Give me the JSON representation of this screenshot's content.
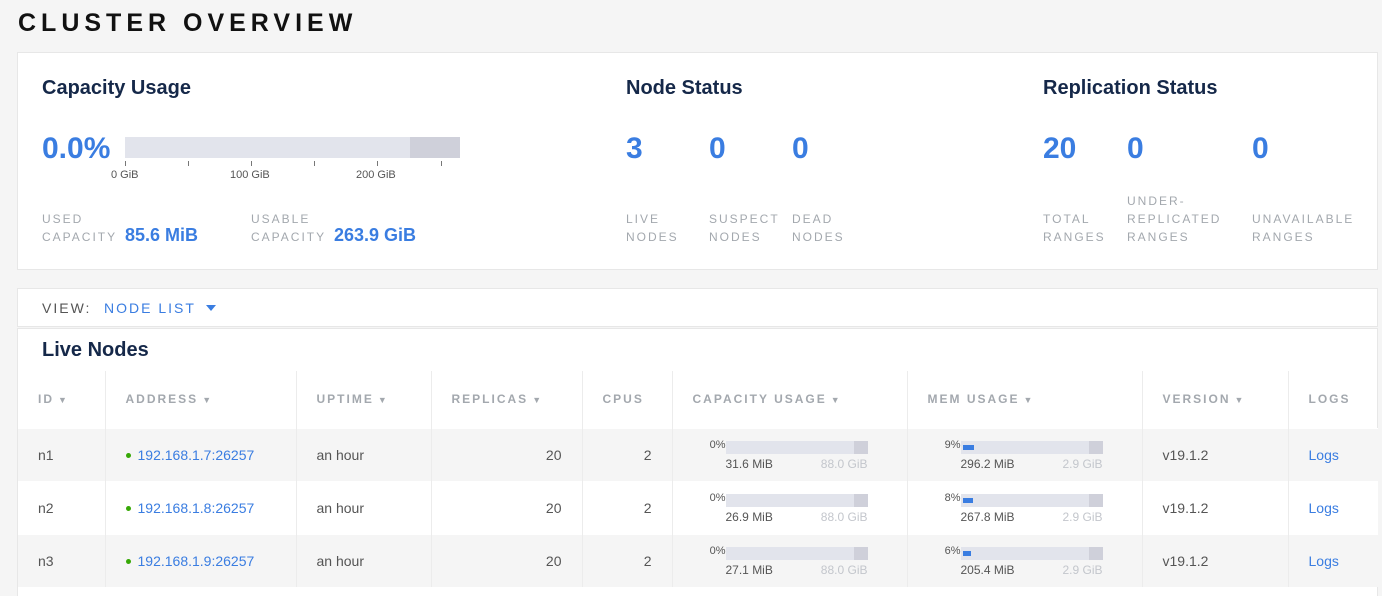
{
  "page": {
    "title": "CLUSTER OVERVIEW"
  },
  "capacity": {
    "title": "Capacity Usage",
    "percent": "0.0%",
    "fill_fraction": 0.0,
    "ticks": [
      "0 GiB",
      "100 GiB",
      "200 GiB"
    ],
    "used_label": "USED CAPACITY",
    "used_value": "85.6 MiB",
    "usable_label": "USABLE CAPACITY",
    "usable_value": "263.9 GiB"
  },
  "node_status": {
    "title": "Node Status",
    "live": "3",
    "live_label": "LIVE NODES",
    "suspect": "0",
    "suspect_label": "SUSPECT NODES",
    "dead": "0",
    "dead_label": "DEAD NODES"
  },
  "replication": {
    "title": "Replication Status",
    "total": "20",
    "total_label": "TOTAL RANGES",
    "under": "0",
    "under_label": "UNDER-REPLICATED RANGES",
    "unavailable": "0",
    "unavailable_label": "UNAVAILABLE RANGES"
  },
  "view": {
    "label": "VIEW:",
    "selected": "NODE LIST"
  },
  "live_nodes": {
    "title": "Live Nodes",
    "columns": {
      "id": "ID",
      "address": "ADDRESS",
      "uptime": "UPTIME",
      "replicas": "REPLICAS",
      "cpus": "CPUS",
      "capacity": "CAPACITY USAGE",
      "mem": "MEM USAGE",
      "version": "VERSION",
      "logs": "LOGS"
    },
    "sort_arrow": "▼",
    "rows": [
      {
        "id": "n1",
        "address": "192.168.1.7:26257",
        "uptime": "an hour",
        "replicas": "20",
        "cpus": "2",
        "cap_pct": "0%",
        "cap_fill": 0.0,
        "cap_used": "31.6 MiB",
        "cap_total": "88.0 GiB",
        "mem_pct": "9%",
        "mem_fill": 0.09,
        "mem_used": "296.2 MiB",
        "mem_total": "2.9 GiB",
        "version": "v19.1.2",
        "logs": "Logs"
      },
      {
        "id": "n2",
        "address": "192.168.1.8:26257",
        "uptime": "an hour",
        "replicas": "20",
        "cpus": "2",
        "cap_pct": "0%",
        "cap_fill": 0.0,
        "cap_used": "26.9 MiB",
        "cap_total": "88.0 GiB",
        "mem_pct": "8%",
        "mem_fill": 0.08,
        "mem_used": "267.8 MiB",
        "mem_total": "2.9 GiB",
        "version": "v19.1.2",
        "logs": "Logs"
      },
      {
        "id": "n3",
        "address": "192.168.1.9:26257",
        "uptime": "an hour",
        "replicas": "20",
        "cpus": "2",
        "cap_pct": "0%",
        "cap_fill": 0.0,
        "cap_used": "27.1 MiB",
        "cap_total": "88.0 GiB",
        "mem_pct": "6%",
        "mem_fill": 0.06,
        "mem_used": "205.4 MiB",
        "mem_total": "2.9 GiB",
        "version": "v19.1.2",
        "logs": "Logs"
      }
    ]
  },
  "colors": {
    "accent": "#3a7de1",
    "live_dot": "#37a806",
    "heading": "#152849"
  }
}
